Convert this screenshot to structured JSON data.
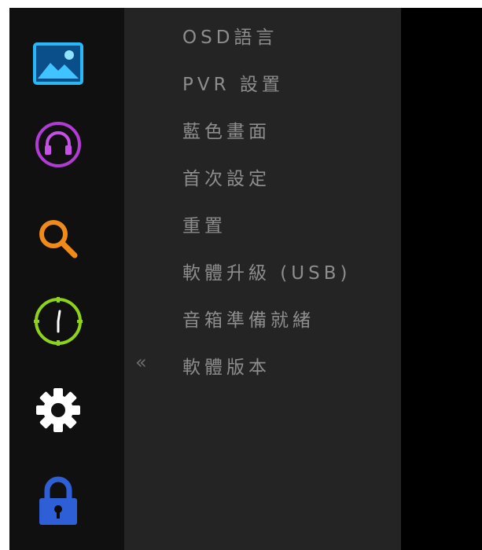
{
  "sidebar": {
    "icons": [
      {
        "name": "picture-icon",
        "color": "#29b6f6"
      },
      {
        "name": "headphones-icon",
        "color": "#b23bd6"
      },
      {
        "name": "search-icon",
        "color": "#f08a18"
      },
      {
        "name": "clock-icon",
        "color": "#8fd21a"
      },
      {
        "name": "gear-icon",
        "color": "#ffffff"
      },
      {
        "name": "lock-icon",
        "color": "#2f5fd6"
      }
    ]
  },
  "menu": {
    "collapse_symbol": "«",
    "items": [
      {
        "label": "OSD語言"
      },
      {
        "label": "PVR 設置"
      },
      {
        "label": "藍色畫面"
      },
      {
        "label": "首次設定"
      },
      {
        "label": "重置"
      },
      {
        "label": "軟體升級 (USB)"
      },
      {
        "label": "音箱準備就緒"
      },
      {
        "label": "軟體版本"
      }
    ]
  }
}
